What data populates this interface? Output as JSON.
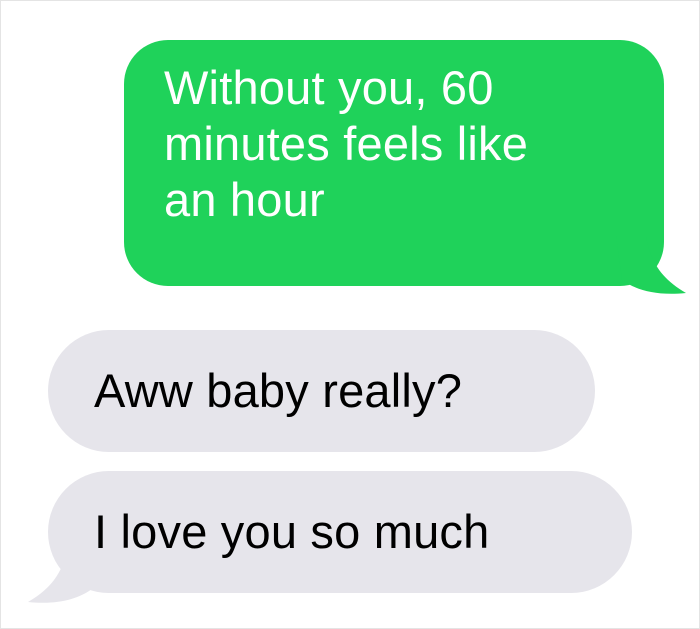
{
  "messages": [
    {
      "direction": "sent",
      "text": "Without you, 60\nminutes feels like\nan hour",
      "bubble_color": "#1fd25a",
      "text_color": "#ffffff"
    },
    {
      "direction": "received",
      "text": "Aww baby really?",
      "bubble_color": "#e6e5eb",
      "text_color": "#000000"
    },
    {
      "direction": "received",
      "text": "I love you so much",
      "bubble_color": "#e6e5eb",
      "text_color": "#000000"
    }
  ]
}
